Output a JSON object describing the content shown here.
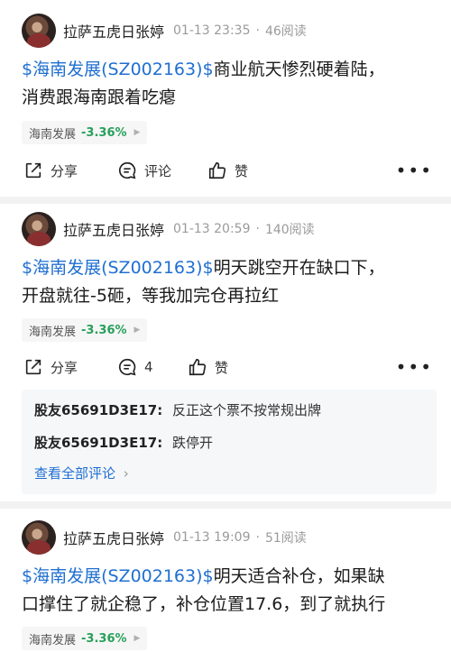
{
  "posts": [
    {
      "author": "拉萨五虎日张婷",
      "time": "01-13 23:35",
      "reads": "46阅读",
      "stock_link": "$海南发展(SZ002163)$",
      "body_line1_rest": "商业航天惨烈硬着陆，",
      "body_line2": "消费跟海南跟着吃瘪",
      "tag_name": "海南发展",
      "tag_change": "-3.36%",
      "share_label": "分享",
      "comment_label": "评论",
      "like_label": "赞"
    },
    {
      "author": "拉萨五虎日张婷",
      "time": "01-13 20:59",
      "reads": "140阅读",
      "stock_link": "$海南发展(SZ002163)$",
      "body_line1_rest": "明天跳空开在缺口下，",
      "body_line2": "开盘就往-5砸，等我加完仓再拉红",
      "tag_name": "海南发展",
      "tag_change": "-3.36%",
      "share_label": "分享",
      "comment_label": "4",
      "like_label": "赞",
      "comments": [
        {
          "user": "股友65691D3E17:",
          "text": "反正这个票不按常规出牌"
        },
        {
          "user": "股友65691D3E17:",
          "text": "跌停开"
        }
      ],
      "see_all": "查看全部评论"
    },
    {
      "author": "拉萨五虎日张婷",
      "time": "01-13 19:09",
      "reads": "51阅读",
      "stock_link": "$海南发展(SZ002163)$",
      "body_line1_rest": "明天适合补仓，如果缺",
      "body_line2": "口撑住了就企稳了，补仓位置17.6，到了就执行",
      "tag_name": "海南发展",
      "tag_change": "-3.36%"
    }
  ],
  "colors": {
    "link": "#1f6fd1",
    "down": "#27a05a",
    "meta": "#9a9a9a"
  },
  "icons": {
    "share": "share-icon",
    "comment": "comment-icon",
    "like": "thumbs-up-icon",
    "more": "more-icon"
  }
}
